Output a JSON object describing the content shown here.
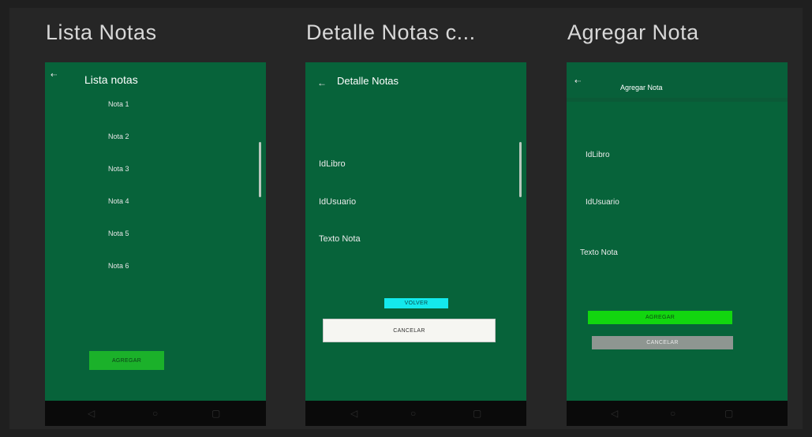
{
  "columns": [
    {
      "title": "Lista Notas"
    },
    {
      "title": "Detalle Notas c..."
    },
    {
      "title": "Agregar Nota"
    }
  ],
  "screen1": {
    "toolbar_title": "Lista notas",
    "items": [
      "Nota 1",
      "Nota 2",
      "Nota 3",
      "Nota 4",
      "Nota 5",
      "Nota 6"
    ],
    "add_button": "AGREGAR"
  },
  "screen2": {
    "toolbar_title": "Detalle Notas",
    "labels": [
      "IdLibro",
      "IdUsuario",
      "Texto Nota"
    ],
    "back_button": "VOLVER",
    "cancel_button": "CANCELAR"
  },
  "screen3": {
    "toolbar_title": "Agregar Nota",
    "labels": [
      "IdLibro",
      "IdUsuario",
      "Texto Nota"
    ],
    "add_button": "AGREGAR",
    "cancel_button": "CANCELAR"
  },
  "nav": {
    "back": "◁",
    "home": "○",
    "recents": "▢"
  },
  "colors": {
    "screen_bg": "#07633a",
    "green_button": "#1bb12a",
    "cyan_button": "#14e9ec",
    "bright_green_button": "#12d60f",
    "gray_button": "#8e9691",
    "white_button": "#f6f6f2",
    "nav_bar": "#0a0a0a"
  }
}
